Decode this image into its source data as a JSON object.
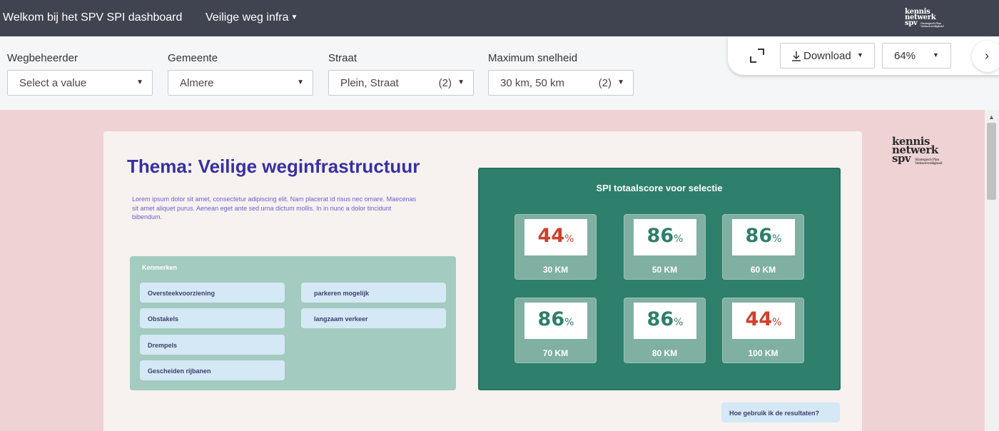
{
  "header": {
    "app_title": "Welkom bij het SPV SPI dashboard",
    "dashboard_select": "Veilige weg infra",
    "logo_text_1": "kennis",
    "logo_text_2": "netwerk",
    "logo_text_3": "spv",
    "logo_small": "Strategisch Plan Verkeersveiligheid"
  },
  "filters": [
    {
      "label": "Wegbeheerder",
      "value": "Select a value",
      "count": ""
    },
    {
      "label": "Gemeente",
      "value": "Almere",
      "count": ""
    },
    {
      "label": "Straat",
      "value": "Plein, Straat",
      "count": "(2)"
    },
    {
      "label": "Maximum snelheid",
      "value": "30 km, 50 km",
      "count": "(2)"
    }
  ],
  "toolbar": {
    "download_label": "Download",
    "zoom_value": "64%"
  },
  "viz": {
    "title": "Thema: Veilige weginfrastructuur",
    "lorem": "Lorem ipsum dolor sit amet, consectetur adipiscing elit. Nam placerat id risus nec ornare. Maecenas sit amet aliquet purus. Aenean eget ante sed urna dictum mollis. In in nunc a dolor tincidunt bibendum.",
    "kenmerken_title": "Kenmerken",
    "kenmerken_left": [
      "Oversteekvoorziening",
      "Obstakels",
      "Drempels",
      "Gescheiden rijbanen"
    ],
    "kenmerken_right": [
      "parkeren mogelijk",
      "langzaam verkeer"
    ],
    "spi_title": "SPI totaalscore voor selectie",
    "tiles": [
      {
        "value": "44",
        "unit": "%",
        "label": "30 KM",
        "color": "#d0402b"
      },
      {
        "value": "86",
        "unit": "%",
        "label": "50 KM",
        "color": "#2e7f6b"
      },
      {
        "value": "86",
        "unit": "%",
        "label": "60 KM",
        "color": "#2e7f6b"
      },
      {
        "value": "86",
        "unit": "%",
        "label": "70 KM",
        "color": "#2e7f6b"
      },
      {
        "value": "86",
        "unit": "%",
        "label": "80 KM",
        "color": "#2e7f6b"
      },
      {
        "value": "44",
        "unit": "%",
        "label": "100 KM",
        "color": "#d0402b"
      }
    ],
    "help_label": "Hoe gebruik ik de resultaten?"
  }
}
